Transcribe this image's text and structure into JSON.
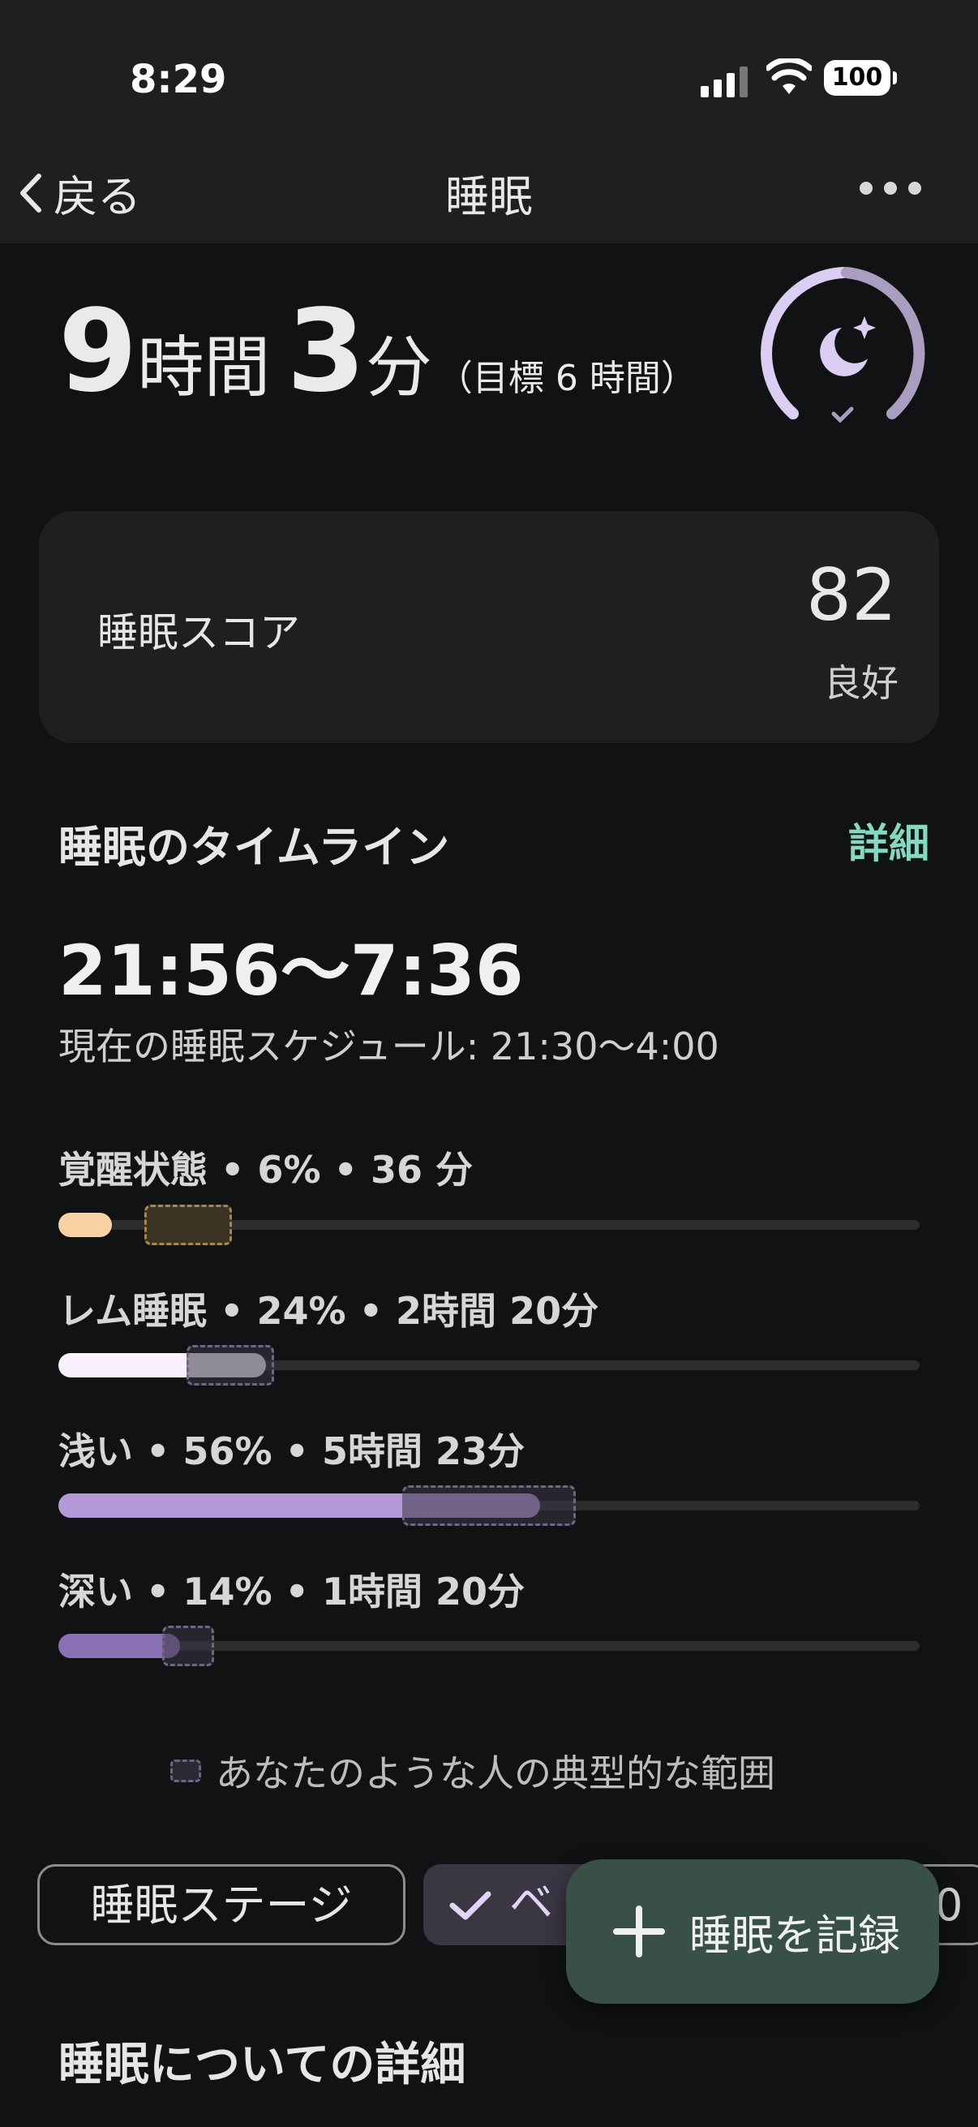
{
  "status_bar": {
    "time": "8:29",
    "battery": "100"
  },
  "nav": {
    "back_label": "戻る",
    "title": "睡眠"
  },
  "summary": {
    "hours": "9",
    "hours_unit": "時間",
    "minutes": "3",
    "minutes_unit": "分",
    "goal": "（目標 6 時間）"
  },
  "score": {
    "label": "睡眠スコア",
    "value": "82",
    "rating": "良好"
  },
  "timeline": {
    "title": "睡眠のタイムライン",
    "details_link": "詳細",
    "time_range": "21:56〜7:36",
    "schedule": "現在の睡眠スケジュール: 21:30〜4:00"
  },
  "stages": [
    {
      "label": "覚醒状態 • 6% • 36 分",
      "percent": 6,
      "color": "#f7d2a4",
      "typical_border": "#a8874f",
      "typical_bg": "#3a3222"
    },
    {
      "label": "レム睡眠 • 24% • 2時間 20分",
      "percent": 24,
      "color": "#f7f2fb",
      "typical_border": "#6e6684",
      "typical_bg": "#3a3646"
    },
    {
      "label": "浅い • 56% • 5時間 23分",
      "percent": 56,
      "color": "#b39ad8",
      "typical_border": "#6e6684",
      "typical_bg": "#3a3646"
    },
    {
      "label": "深い • 14% • 1時間 20分",
      "percent": 14,
      "color": "#8a70b4",
      "typical_border": "#6e6684",
      "typical_bg": "#3a3646"
    }
  ],
  "legend": {
    "label": "あなたのような人の典型的な範囲"
  },
  "chips": {
    "stages": "睡眠ステージ",
    "selected": "ベ",
    "partial": "0"
  },
  "fab": {
    "label": "睡眠を記録"
  },
  "details_section": {
    "title": "睡眠についての詳細"
  },
  "colors": {
    "accent": "#86d8c0",
    "fab_bg": "#385048",
    "ring": "#dccdf3"
  }
}
